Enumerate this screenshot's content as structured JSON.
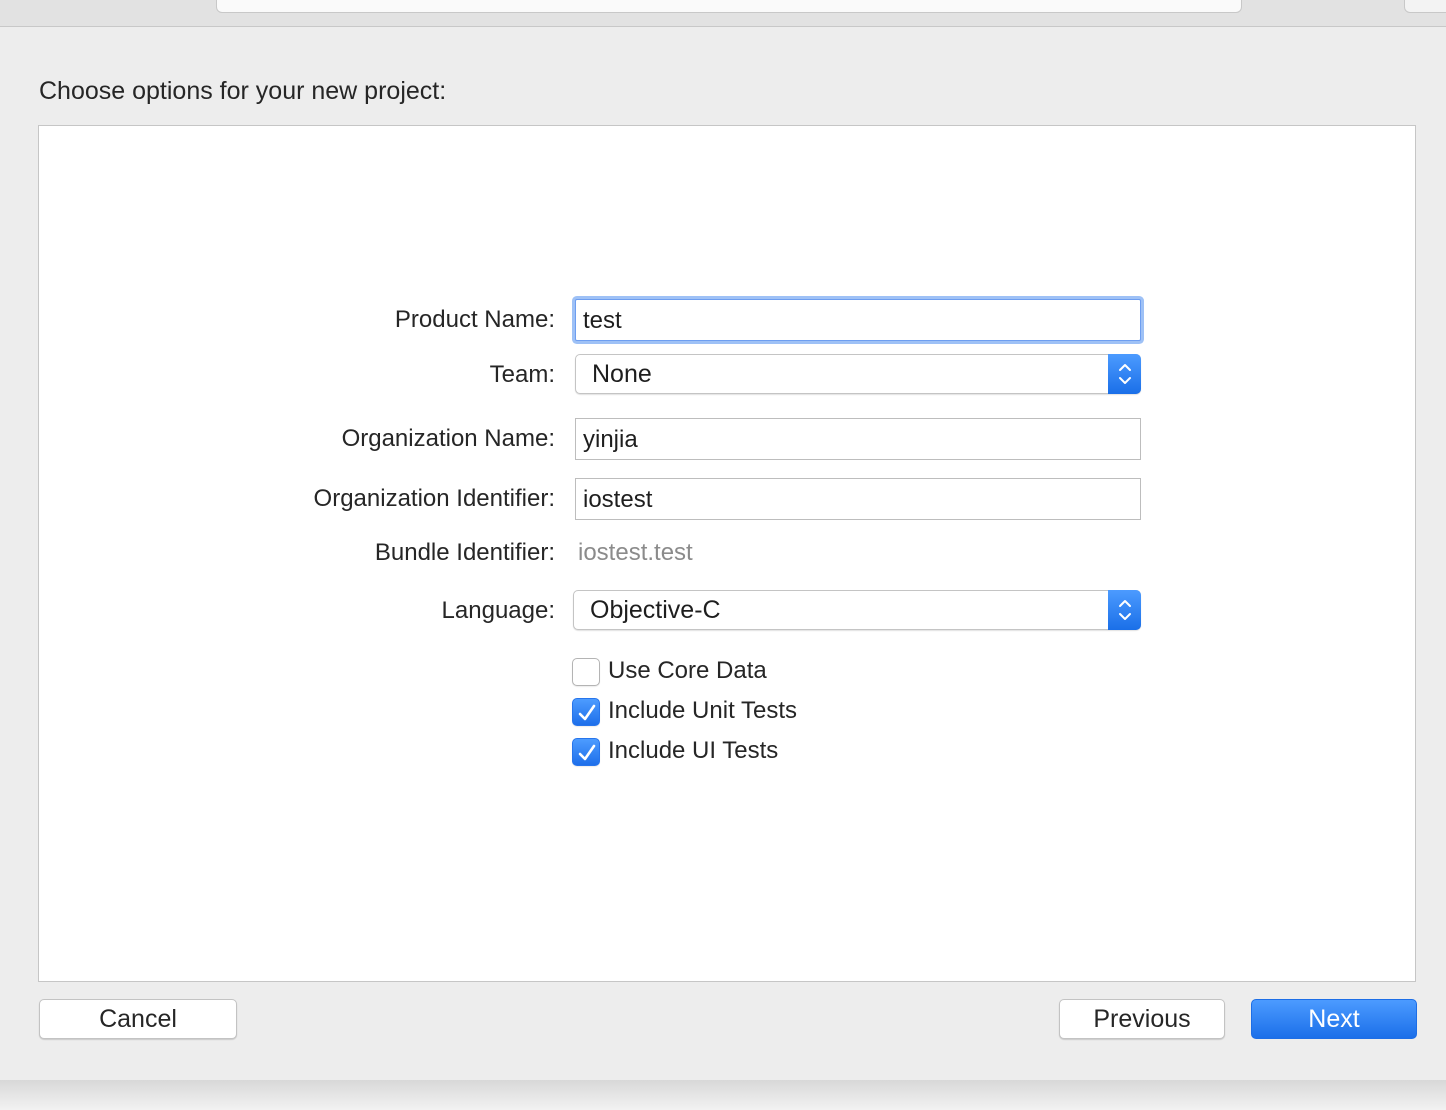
{
  "dialog": {
    "heading": "Choose options for your new project:"
  },
  "form": {
    "product_name": {
      "label": "Product Name:",
      "value": "test"
    },
    "team": {
      "label": "Team:",
      "value": "None"
    },
    "organization_name": {
      "label": "Organization Name:",
      "value": "yinjia"
    },
    "organization_identifier": {
      "label": "Organization Identifier:",
      "value": "iostest"
    },
    "bundle_identifier": {
      "label": "Bundle Identifier:",
      "value": "iostest.test"
    },
    "language": {
      "label": "Language:",
      "value": "Objective-C"
    },
    "options": [
      {
        "label": "Use Core Data",
        "checked": false
      },
      {
        "label": "Include Unit Tests",
        "checked": true
      },
      {
        "label": "Include UI Tests",
        "checked": true
      }
    ]
  },
  "buttons": {
    "cancel": "Cancel",
    "previous": "Previous",
    "next": "Next"
  },
  "colors": {
    "accent": "#1b6fe9",
    "focus_ring": "#9ec1f6",
    "panel_background": "#ffffff",
    "window_background": "#ededed"
  },
  "icons": {
    "stepper": "up-down-chevron-icon",
    "check": "checkmark-icon"
  }
}
